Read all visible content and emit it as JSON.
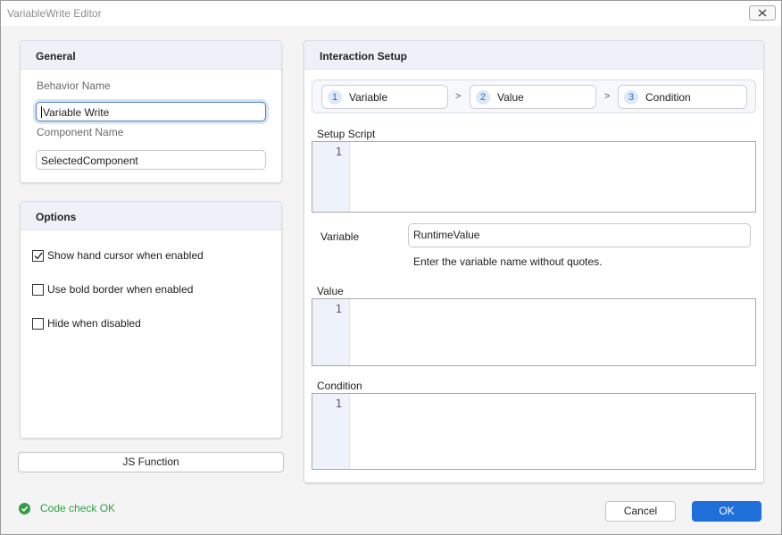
{
  "window": {
    "title": "VariableWrite Editor",
    "close_icon": "close-x-icon"
  },
  "general": {
    "title": "General",
    "behavior_name_label": "Behavior Name",
    "behavior_name_value": "Variable Write",
    "component_name_label": "Component Name",
    "component_name_value": "SelectedComponent"
  },
  "options": {
    "title": "Options",
    "items": [
      {
        "label": "Show hand cursor when enabled",
        "checked": true
      },
      {
        "label": "Use bold border when enabled",
        "checked": false
      },
      {
        "label": "Hide when disabled",
        "checked": false
      }
    ]
  },
  "js_function_label": "JS Function",
  "interaction": {
    "title": "Interaction Setup",
    "steps": [
      {
        "num": "1",
        "label": "Variable"
      },
      {
        "num": "2",
        "label": "Value"
      },
      {
        "num": "3",
        "label": "Condition"
      }
    ],
    "step_separator": ">",
    "setup_script_label": "Setup Script",
    "setup_script_line": "1",
    "variable_label": "Variable",
    "variable_value": "RuntimeValue",
    "variable_hint": "Enter the variable name without quotes.",
    "value_label": "Value",
    "value_line": "1",
    "condition_label": "Condition",
    "condition_line": "1"
  },
  "footer": {
    "status_icon": "check-circle-icon",
    "status_text": "Code check OK",
    "status_color": "#2e9e44",
    "cancel_label": "Cancel",
    "ok_label": "OK",
    "accent_color": "#1e6fd9"
  }
}
